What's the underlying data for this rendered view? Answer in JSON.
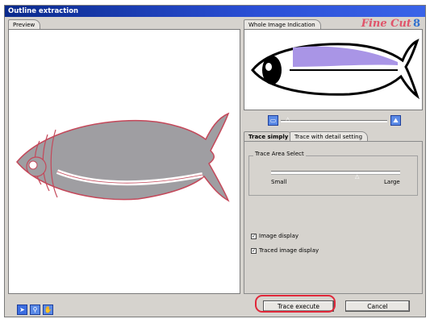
{
  "window": {
    "title": "Outline extraction"
  },
  "logo": {
    "text": "Fine Cut",
    "number": "8"
  },
  "preview": {
    "tab_label": "Preview"
  },
  "whole_image": {
    "tab_label": "Whole Image Indication"
  },
  "trace_tabs": [
    {
      "label": "Trace simply",
      "active": true
    },
    {
      "label": "Trace with detail setting",
      "active": false
    }
  ],
  "trace_area": {
    "group_label": "Trace Area Select",
    "min_label": "Small",
    "max_label": "Large",
    "slider_level": 0.7
  },
  "zoom": {
    "slider_level": 0.05
  },
  "options": {
    "image_display": {
      "label": "Image display",
      "checked": true
    },
    "traced_display": {
      "label": "Traced image display",
      "checked": true
    }
  },
  "tools": [
    "arrow-icon",
    "magnifier-icon",
    "hand-icon"
  ],
  "buttons": {
    "execute": "Trace execute",
    "cancel": "Cancel"
  },
  "colors": {
    "accent": "#e0283a",
    "fish_fill": "#9f9ea2",
    "thumb_fill": "#a995e6",
    "titlebar": "#0a2a8c"
  }
}
